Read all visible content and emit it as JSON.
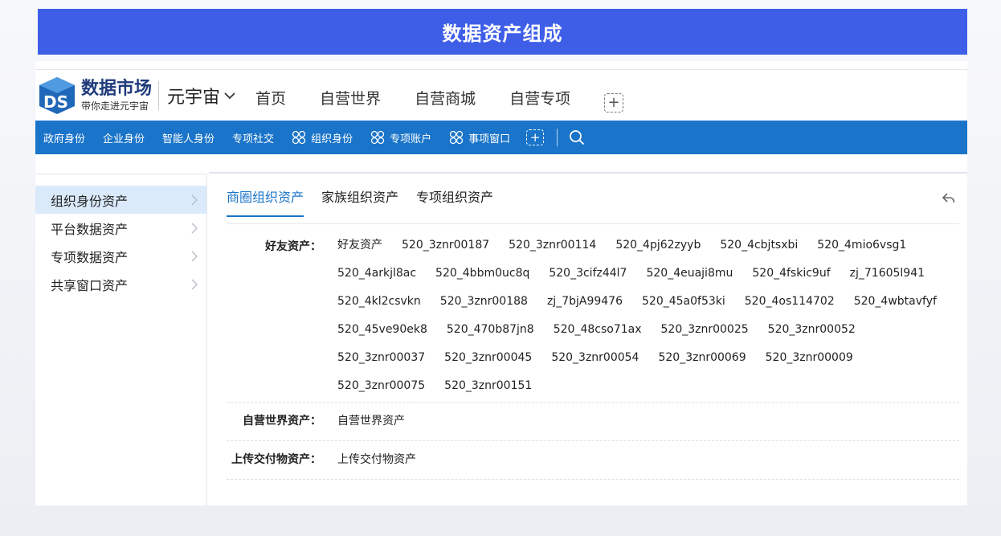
{
  "page_title": "数据资产组成",
  "logo": {
    "main": "数据市场",
    "sub": "带你走进元宇宙",
    "icon": "data-market-logo-icon"
  },
  "universe": {
    "label": "元宇宙",
    "icon": "chevron-down-icon"
  },
  "main_nav": [
    "首页",
    "自营世界",
    "自营商城",
    "自营专项"
  ],
  "main_nav_add": "+",
  "sub_nav": {
    "plain": [
      "政府身份",
      "企业身份",
      "智能人身份",
      "专项社交"
    ],
    "grid": [
      "组织身份",
      "专项账户",
      "事项窗口"
    ],
    "add": "+",
    "search_icon": "search-icon"
  },
  "sidebar": {
    "items": [
      "组织身份资产",
      "平台数据资产",
      "专项数据资产",
      "共享窗口资产"
    ]
  },
  "tabs": [
    "商圈组织资产",
    "家族组织资产",
    "专项组织资产"
  ],
  "rows": [
    {
      "label": "好友资产：",
      "items": [
        "好友资产",
        "520_3znr00187",
        "520_3znr00114",
        "520_4pj62zyyb",
        "520_4cbjtsxbi",
        "520_4mio6vsg1",
        "520_4arkjl8ac",
        "520_4bbm0uc8q",
        "520_3cifz44l7",
        "520_4euaji8mu",
        "520_4fskic9uf",
        "zj_71605l941",
        "520_4kl2csvkn",
        "520_3znr00188",
        "zj_7bjA99476",
        "520_45a0f53ki",
        "520_4os114702",
        "520_4wbtavfyf",
        "520_45ve90ek8",
        "520_470b87jn8",
        "520_48cso71ax",
        "520_3znr00025",
        "520_3znr00052",
        "520_3znr00037",
        "520_3znr00045",
        "520_3znr00054",
        "520_3znr00069",
        "520_3znr00009",
        "520_3znr00075",
        "520_3znr00151"
      ]
    },
    {
      "label": "自营世界资产：",
      "items": [
        "自营世界资产"
      ]
    },
    {
      "label": "上传交付物资产：",
      "items": [
        "上传交付物资产"
      ]
    }
  ],
  "colors": {
    "title_bar": "#3f5ee8",
    "sub_nav": "#1a74c9",
    "accent": "#1a74c9",
    "sidebar_active": "#dbeafb"
  }
}
